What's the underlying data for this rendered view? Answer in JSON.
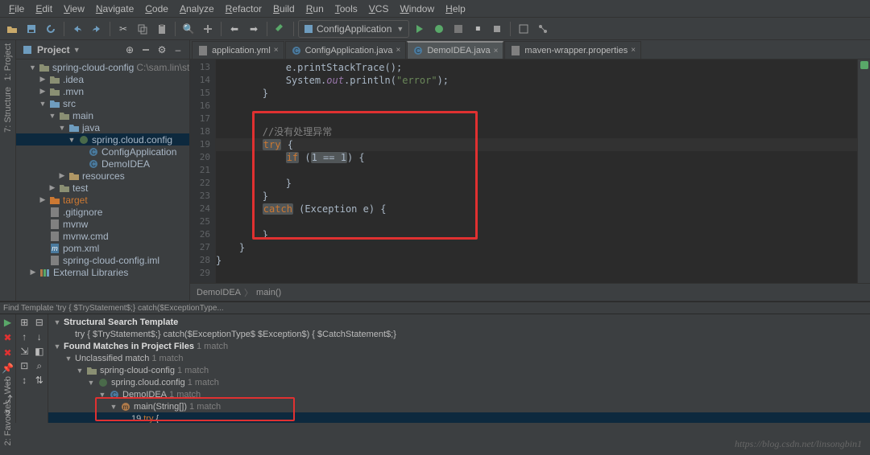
{
  "menus": [
    "File",
    "Edit",
    "View",
    "Navigate",
    "Code",
    "Analyze",
    "Refactor",
    "Build",
    "Run",
    "Tools",
    "VCS",
    "Window",
    "Help"
  ],
  "run_config_label": "ConfigApplication",
  "project": {
    "panel_title": "Project",
    "root_label": "spring-cloud-config",
    "root_path": "C:\\sam.lin\\study\\sprin",
    "nodes": [
      {
        "depth": 1,
        "tw": "▼",
        "icon": "folder",
        "label": "spring-cloud-config",
        "trail": "C:\\sam.lin\\study\\sprin"
      },
      {
        "depth": 2,
        "tw": "▶",
        "icon": "folder",
        "label": ".idea"
      },
      {
        "depth": 2,
        "tw": "▶",
        "icon": "folder",
        "label": ".mvn"
      },
      {
        "depth": 2,
        "tw": "▼",
        "icon": "src-folder",
        "label": "src"
      },
      {
        "depth": 3,
        "tw": "▼",
        "icon": "folder",
        "label": "main"
      },
      {
        "depth": 4,
        "tw": "▼",
        "icon": "src-folder",
        "label": "java"
      },
      {
        "depth": 5,
        "tw": "▼",
        "icon": "package",
        "label": "spring.cloud.config",
        "selected": true
      },
      {
        "depth": 6,
        "tw": "",
        "icon": "class",
        "label": "ConfigApplication"
      },
      {
        "depth": 6,
        "tw": "",
        "icon": "class",
        "label": "DemoIDEA"
      },
      {
        "depth": 4,
        "tw": "▶",
        "icon": "res-folder",
        "label": "resources"
      },
      {
        "depth": 3,
        "tw": "▶",
        "icon": "folder",
        "label": "test"
      },
      {
        "depth": 2,
        "tw": "▶",
        "icon": "target-folder",
        "label": "target",
        "orange": true
      },
      {
        "depth": 2,
        "tw": "",
        "icon": "file",
        "label": ".gitignore"
      },
      {
        "depth": 2,
        "tw": "",
        "icon": "file",
        "label": "mvnw"
      },
      {
        "depth": 2,
        "tw": "",
        "icon": "file",
        "label": "mvnw.cmd"
      },
      {
        "depth": 2,
        "tw": "",
        "icon": "maven",
        "label": "pom.xml"
      },
      {
        "depth": 2,
        "tw": "",
        "icon": "file",
        "label": "spring-cloud-config.iml"
      },
      {
        "depth": 1,
        "tw": "▶",
        "icon": "lib",
        "label": "External Libraries"
      }
    ]
  },
  "left_strip": {
    "top": [
      "1: Project",
      "7: Structure"
    ],
    "bottom": [
      "Web",
      "2: Favorites"
    ]
  },
  "editor": {
    "tabs": [
      {
        "label": "application.yml",
        "icon": "yml"
      },
      {
        "label": "ConfigApplication.java",
        "icon": "class"
      },
      {
        "label": "DemoIDEA.java",
        "icon": "class",
        "active": true
      },
      {
        "label": "maven-wrapper.properties",
        "icon": "props"
      }
    ],
    "lines": [
      {
        "n": 13,
        "html": "            e.printStackTrace();"
      },
      {
        "n": 14,
        "html": "            System.<span class='field'>out</span>.println(<span class='str'>\"error\"</span>);"
      },
      {
        "n": 15,
        "html": "        }"
      },
      {
        "n": 16,
        "html": ""
      },
      {
        "n": 17,
        "html": ""
      },
      {
        "n": 18,
        "html": "        <span class='cmt'>//没有处理异常</span>"
      },
      {
        "n": 19,
        "html": "        <span class='kw hl'>try</span> {",
        "caret": true
      },
      {
        "n": 20,
        "html": "            <span class='kw hl'>if</span> (<span class='hl'>1 == 1</span>) {"
      },
      {
        "n": 21,
        "html": ""
      },
      {
        "n": 22,
        "html": "            }"
      },
      {
        "n": 23,
        "html": "        }"
      },
      {
        "n": 24,
        "html": "        <span class='kw hl'>catch</span> (Exception e) {"
      },
      {
        "n": 25,
        "html": ""
      },
      {
        "n": 26,
        "html": "        }"
      },
      {
        "n": 27,
        "html": "    }"
      },
      {
        "n": 28,
        "html": "}"
      },
      {
        "n": 29,
        "html": ""
      }
    ],
    "breadcrumb": [
      "DemoIDEA",
      "main()"
    ]
  },
  "find_bar_text": "Find Template 'try {  $TryStatement$;} catch($ExceptionType...",
  "find_panel": {
    "rows": [
      {
        "depth": 0,
        "tw": "▼",
        "label": "Structural Search Template",
        "bold": true
      },
      {
        "depth": 1,
        "tw": "",
        "label": "try {  $TryStatement$;} catch($ExceptionType$ $Exception$) {  $CatchStatement$;}"
      },
      {
        "depth": 0,
        "tw": "▼",
        "label": "Found Matches in Project Files",
        "bold": true,
        "trail": "1 match"
      },
      {
        "depth": 1,
        "tw": "▼",
        "label": "Unclassified match",
        "trail": "1 match"
      },
      {
        "depth": 2,
        "tw": "▼",
        "icon": "folder",
        "label": "spring-cloud-config",
        "trail": "1 match"
      },
      {
        "depth": 3,
        "tw": "▼",
        "icon": "package",
        "label": "spring.cloud.config",
        "trail": "1 match"
      },
      {
        "depth": 4,
        "tw": "▼",
        "icon": "class",
        "label": "DemoIDEA",
        "trail": "1 match"
      },
      {
        "depth": 5,
        "tw": "▼",
        "icon": "method",
        "label": "main(String[])",
        "trail": "1 match"
      },
      {
        "depth": 6,
        "tw": "",
        "label": "19 ",
        "code": "try {",
        "sel": true
      }
    ]
  },
  "watermark": "https://blog.csdn.net/linsongbin1"
}
